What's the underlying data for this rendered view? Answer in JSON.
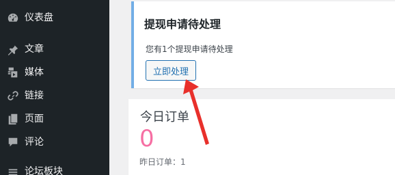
{
  "sidebar": {
    "items": [
      {
        "label": "仪表盘",
        "icon": "dashboard-icon"
      },
      {
        "label": "文章",
        "icon": "pin-icon"
      },
      {
        "label": "媒体",
        "icon": "media-icon"
      },
      {
        "label": "链接",
        "icon": "link-icon"
      },
      {
        "label": "页面",
        "icon": "page-icon"
      },
      {
        "label": "评论",
        "icon": "comment-icon"
      },
      {
        "label": "论坛板块",
        "icon": "forum-icon"
      }
    ]
  },
  "notice": {
    "title": "提现申请待处理",
    "text": "您有1个提现申请待处理",
    "button": "立即处理"
  },
  "orders": {
    "title": "今日订单",
    "count": "0",
    "yesterday": "昨日订单：1"
  },
  "colors": {
    "sidebar_bg": "#1d2327",
    "accent": "#2271b1",
    "count": "#f66fa3",
    "annotation": "#e8302b"
  }
}
